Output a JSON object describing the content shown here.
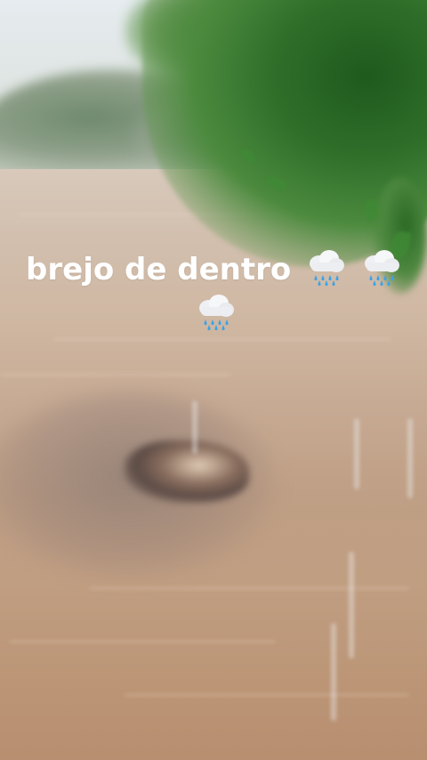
{
  "story": {
    "caption_text": "brejo de dentro",
    "caption_icons": [
      "cloud-with-rain-icon",
      "cloud-with-rain-icon",
      "cloud-with-rain-icon"
    ]
  },
  "colors": {
    "caption": "#ffffff",
    "water": "#c7aa93",
    "foliage": "#2f6f2a",
    "rain_drops": "#3aa3e8"
  }
}
